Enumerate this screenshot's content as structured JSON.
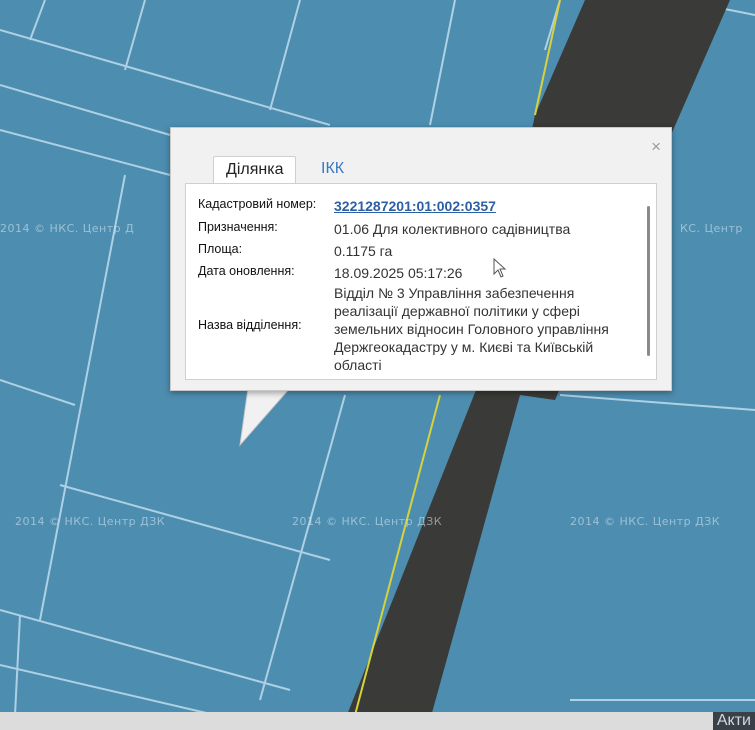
{
  "map": {
    "watermark_text": "2014 © НКС. Центр ДЗК",
    "watermark_left_text": "2014 © НКС. Центр Д",
    "watermark_right_text": "КС. Центр",
    "colors": {
      "background": "#4f8fb2",
      "parcel_lines": "#b8d6e8",
      "road": "#3a3a38",
      "road_edge": "#d8d23a"
    }
  },
  "popup": {
    "close_label": "×",
    "tabs": [
      {
        "label": "Ділянка",
        "active": true
      },
      {
        "label": "ІКК",
        "active": false
      }
    ],
    "fields": [
      {
        "label": "Кадастровий номер:",
        "value": "3221287201:01:002:0357"
      },
      {
        "label": "Призначення:",
        "value": "01.06 Для колективного садівництва"
      },
      {
        "label": "Площа:",
        "value": "0.1175 га"
      },
      {
        "label": "Дата оновлення:",
        "value": "18.09.2025 05:17:26"
      },
      {
        "label": "Назва відділення:",
        "value": "Відділ № 3 Управління забезпечення реалізації державної політики у сфері земельних відносин Головного управління Держгеокадастру у м. Києві та Київській області"
      }
    ]
  },
  "taskbar": {
    "text": "Акти"
  }
}
